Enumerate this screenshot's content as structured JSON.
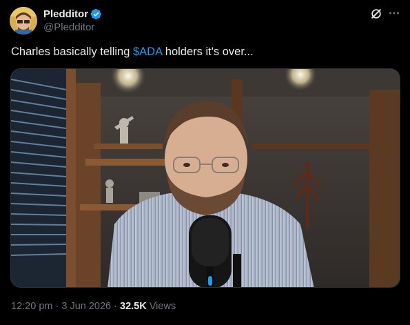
{
  "author": {
    "display_name": "Pledditor",
    "handle": "@Pledditor",
    "verified": true,
    "verified_color": "#1d9bf0"
  },
  "tweet": {
    "text_before": "Charles basically telling ",
    "cashtag": "$ADA",
    "text_after": " holders it's over...",
    "cashtag_color": "#1d9bf0"
  },
  "actions": {
    "grok_icon": "grok-icon",
    "more_icon": "more-icon"
  },
  "footer": {
    "time": "12:20 pm",
    "separator_1": " · ",
    "date": "3 Jun 2026",
    "separator_2": " · ",
    "views_count": "32.5K",
    "views_label": " Views"
  },
  "colors": {
    "background": "#000000",
    "text_primary": "#e7e9ea",
    "text_secondary": "#71767b",
    "accent": "#1d9bf0"
  }
}
